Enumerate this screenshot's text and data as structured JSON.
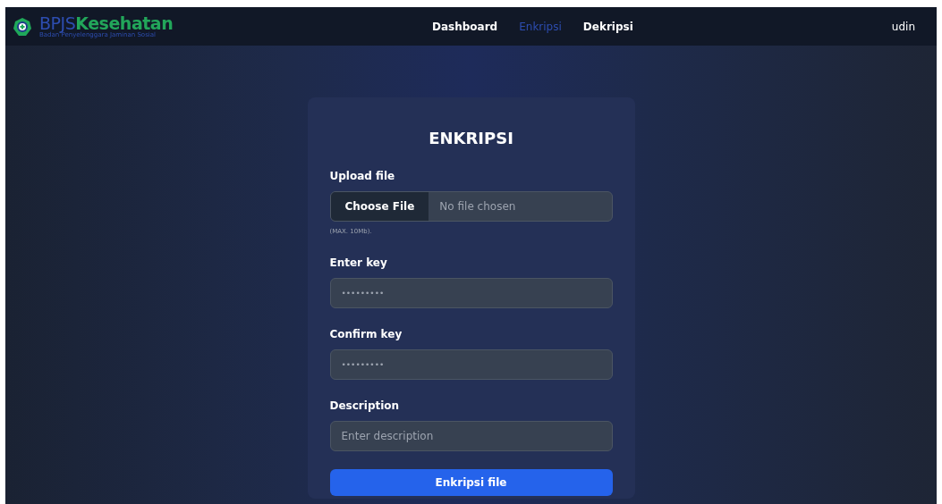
{
  "navbar": {
    "logo": {
      "title_part1": "BPJS",
      "title_part2": "Kesehatan",
      "subtitle": "Badan Penyelenggara Jaminan Sosial"
    },
    "links": [
      {
        "label": "Dashboard",
        "selected": false
      },
      {
        "label": "Enkripsi",
        "selected": true
      },
      {
        "label": "Dekripsi",
        "selected": false
      }
    ],
    "user": "udin"
  },
  "form": {
    "title": "ENKRIPSI",
    "fields": [
      {
        "kind": "file",
        "label": "Upload file",
        "button": "Choose File",
        "status": "No file chosen",
        "hint": "(MAX. 10Mb)."
      },
      {
        "kind": "text",
        "label": "Enter key",
        "value": "•••••••••"
      },
      {
        "kind": "text",
        "label": "Confirm key",
        "value": "•••••••••"
      },
      {
        "kind": "placeholder",
        "label": "Description",
        "placeholder": "Enter description"
      }
    ],
    "submit": "Enkripsi file"
  }
}
